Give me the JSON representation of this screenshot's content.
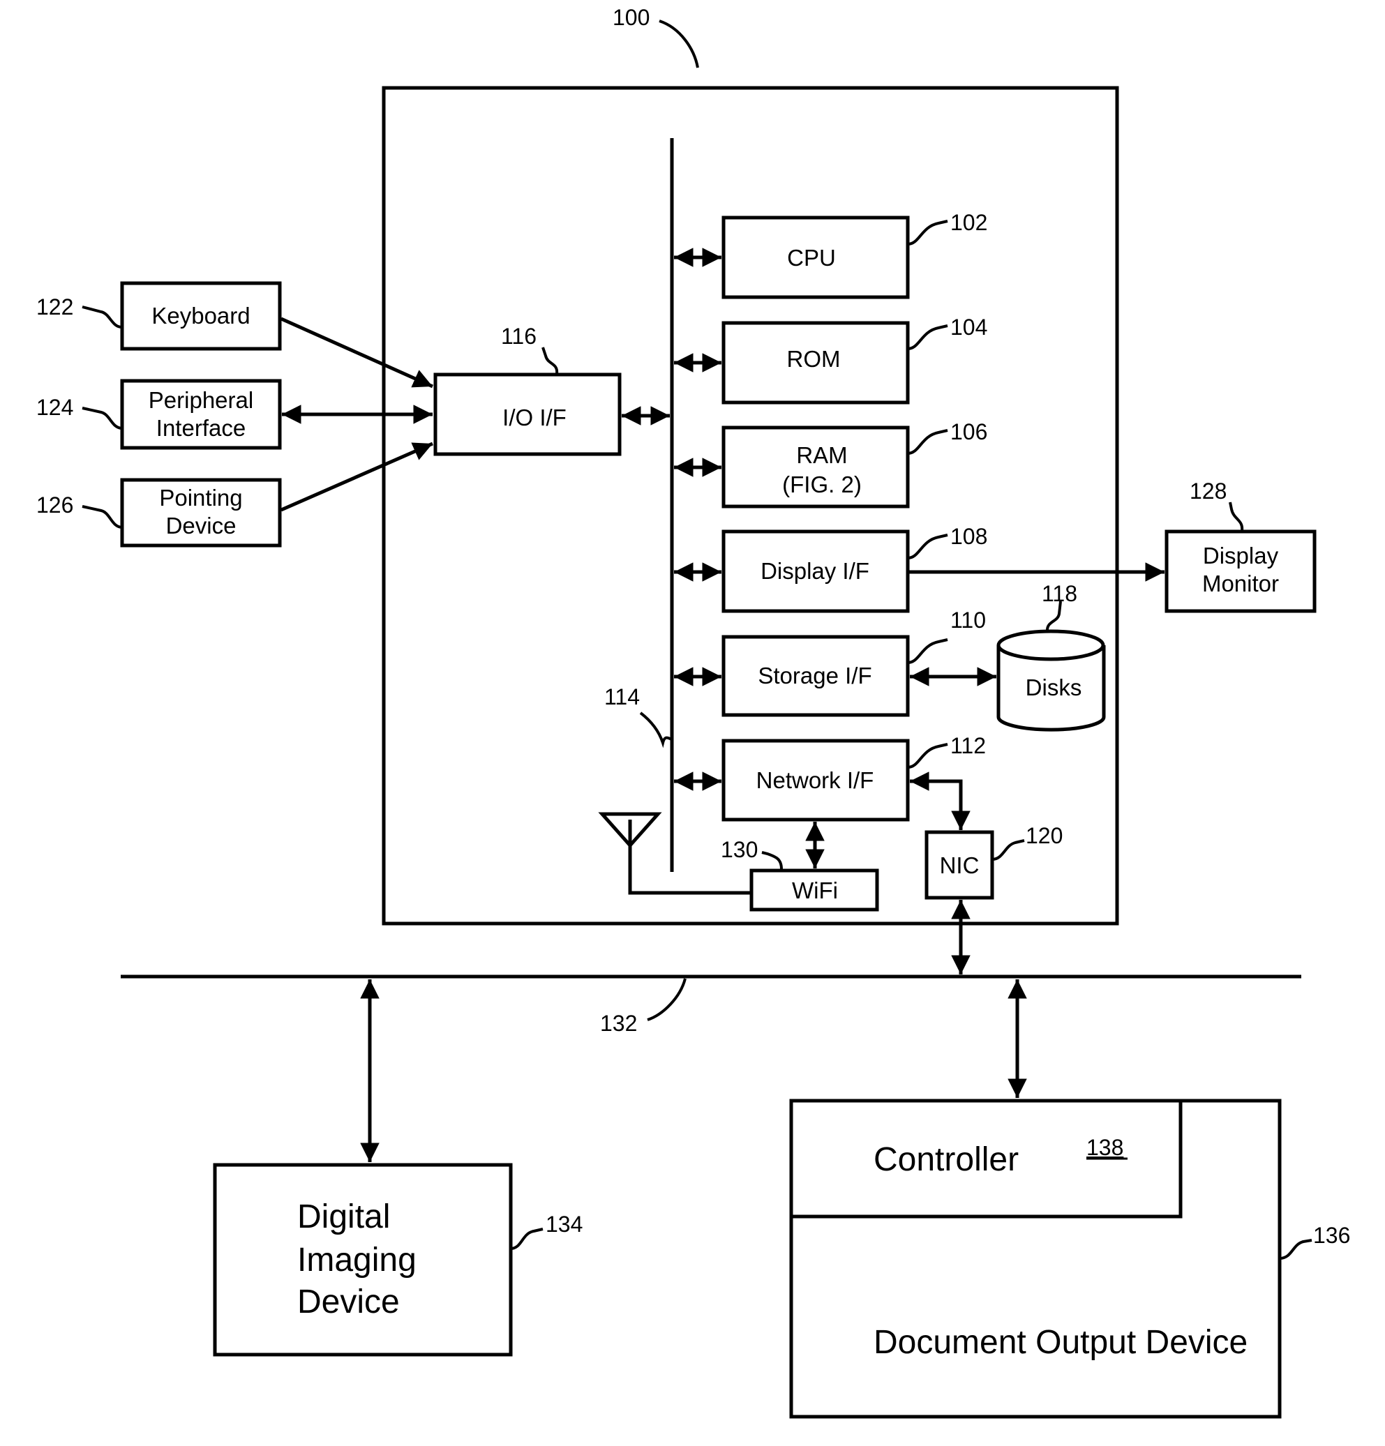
{
  "figure": {
    "system_ref": "100",
    "bus_ref": "114",
    "network_ref": "132"
  },
  "internal_blocks": [
    {
      "id": "cpu",
      "label": "CPU",
      "label2": "",
      "ref": "102"
    },
    {
      "id": "rom",
      "label": "ROM",
      "label2": "",
      "ref": "104"
    },
    {
      "id": "ram",
      "label": "RAM",
      "label2": "(FIG. 2)",
      "ref": "106"
    },
    {
      "id": "display-if",
      "label": "Display I/F",
      "label2": "",
      "ref": "108"
    },
    {
      "id": "storage-if",
      "label": "Storage I/F",
      "label2": "",
      "ref": "110"
    },
    {
      "id": "network-if",
      "label": "Network I/F",
      "label2": "",
      "ref": "112"
    }
  ],
  "io_if": {
    "label": "I/O I/F",
    "ref": "116"
  },
  "peripherals": [
    {
      "id": "keyboard",
      "label": "Keyboard",
      "label2": "",
      "ref": "122"
    },
    {
      "id": "peripheral-interface",
      "label": "Peripheral",
      "label2": "Interface",
      "ref": "124"
    },
    {
      "id": "pointing-device",
      "label": "Pointing",
      "label2": "Device",
      "ref": "126"
    }
  ],
  "display_monitor": {
    "label": "Display",
    "label2": "Monitor",
    "ref": "128"
  },
  "disks": {
    "label": "Disks",
    "ref": "118"
  },
  "nic": {
    "label": "NIC",
    "ref": "120"
  },
  "wifi": {
    "label": "WiFi",
    "ref": "130"
  },
  "digital_imaging": {
    "line1": "Digital",
    "line2": "Imaging",
    "line3": "Device",
    "ref": "134"
  },
  "document_output": {
    "label": "Document Output Device",
    "ref": "136"
  },
  "controller": {
    "label": "Controller",
    "ref": "138"
  }
}
